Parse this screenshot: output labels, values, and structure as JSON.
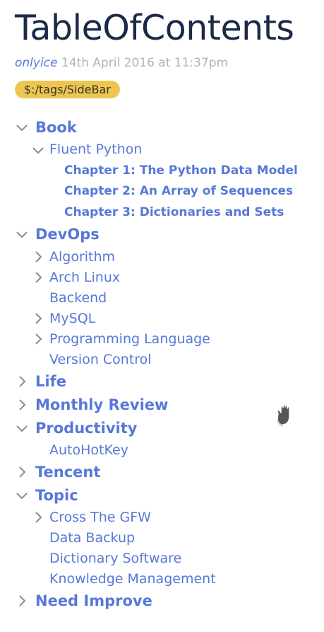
{
  "page": {
    "title": "TableOfContents",
    "author": "onlyice",
    "date": "14th April 2016 at 11:37pm",
    "tag": "$:/tags/SideBar"
  },
  "toc": {
    "book": "Book",
    "fluent_python": "Fluent Python",
    "chapter1": "Chapter 1: The Python Data Model",
    "chapter2": "Chapter 2: An Array of Sequences",
    "chapter3": "Chapter 3: Dictionaries and Sets",
    "devops": "DevOps",
    "algorithm": "Algorithm",
    "arch_linux": "Arch Linux",
    "backend": "Backend",
    "mysql": "MySQL",
    "programming_language": "Programming Language",
    "version_control": "Version Control",
    "life": "Life",
    "monthly_review": "Monthly Review",
    "productivity": "Productivity",
    "autohotkey": "AutoHotKey",
    "tencent": "Tencent",
    "topic": "Topic",
    "cross_the_gfw": "Cross The GFW",
    "data_backup": "Data Backup",
    "dictionary_software": "Dictionary Software",
    "knowledge_management": "Knowledge Management",
    "need_improve": "Need Improve"
  },
  "colors": {
    "link": "#5778d8",
    "title": "#1a2a47",
    "meta": "#b3b3b3",
    "tag_bg": "#ecc64f",
    "twisty": "#8c8c8c"
  },
  "icons": {
    "expanded": "chevron-down-icon",
    "collapsed": "chevron-right-icon",
    "cursor": "grab-hand-cursor-icon"
  }
}
